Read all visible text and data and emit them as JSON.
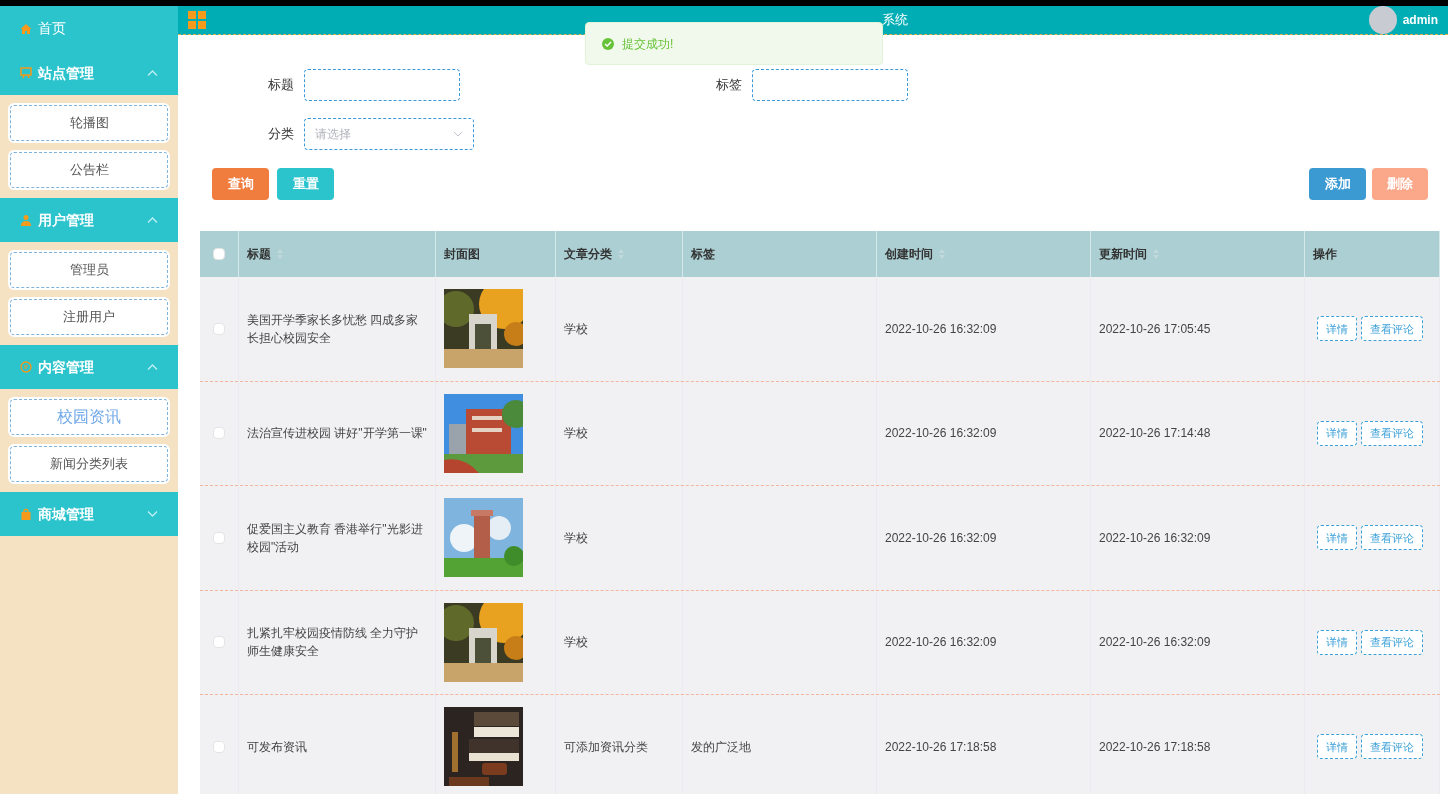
{
  "sidebar": {
    "home": {
      "label": "首页"
    },
    "sections": [
      {
        "label": "站点管理",
        "expanded": true,
        "items": [
          {
            "label": "轮播图",
            "selected": false
          },
          {
            "label": "公告栏",
            "selected": false
          }
        ]
      },
      {
        "label": "用户管理",
        "expanded": true,
        "items": [
          {
            "label": "管理员",
            "selected": false
          },
          {
            "label": "注册用户",
            "selected": false
          }
        ]
      },
      {
        "label": "内容管理",
        "expanded": true,
        "items": [
          {
            "label": "校园资讯",
            "selected": true
          },
          {
            "label": "新闻分类列表",
            "selected": false
          }
        ]
      },
      {
        "label": "商城管理",
        "expanded": false
      }
    ]
  },
  "header": {
    "title": "系统",
    "user": "admin"
  },
  "toast": {
    "message": "提交成功!"
  },
  "filters": {
    "title_label": "标题",
    "tag_label": "标签",
    "category_label": "分类",
    "category_placeholder": "请选择"
  },
  "buttons": {
    "query": "查询",
    "reset": "重置",
    "add": "添加",
    "delete": "删除"
  },
  "table": {
    "select_all_checked": false,
    "columns": [
      {
        "label": "标题",
        "sortable": true
      },
      {
        "label": "封面图",
        "sortable": false
      },
      {
        "label": "文章分类",
        "sortable": true
      },
      {
        "label": "标签",
        "sortable": false
      },
      {
        "label": "创建时间",
        "sortable": true
      },
      {
        "label": "更新时间",
        "sortable": true
      },
      {
        "label": "操作",
        "sortable": false
      }
    ],
    "rows": [
      {
        "checked": false,
        "title": "美国开学季家长多忧愁 四成多家长担心校园安全",
        "category": "学校",
        "created": "2022-10-26 16:32:09",
        "updated": "2022-10-26 17:05:45",
        "actions": [
          "详情",
          "查看评论"
        ]
      },
      {
        "checked": false,
        "title": "法治宣传进校园 讲好\"开学第一课\"",
        "category": "学校",
        "created": "2022-10-26 16:32:09",
        "updated": "2022-10-26 17:14:48",
        "actions": [
          "详情",
          "查看评论"
        ]
      },
      {
        "checked": false,
        "title": "促爱国主义教育 香港举行\"光影进校园\"活动",
        "category": "学校",
        "created": "2022-10-26 16:32:09",
        "updated": "2022-10-26 16:32:09",
        "actions": [
          "详情",
          "查看评论"
        ]
      },
      {
        "checked": false,
        "title": "扎紧扎牢校园疫情防线 全力守护师生健康安全",
        "category": "学校",
        "created": "2022-10-26 16:32:09",
        "updated": "2022-10-26 16:32:09",
        "actions": [
          "详情",
          "查看评论"
        ]
      },
      {
        "checked": false,
        "title": "可发布资讯",
        "category": "可添加资讯分类",
        "tag": "发的广泛地",
        "created": "2022-10-26 17:18:58",
        "updated": "2022-10-26 17:18:58",
        "actions": [
          "详情",
          "查看评论"
        ]
      }
    ]
  }
}
